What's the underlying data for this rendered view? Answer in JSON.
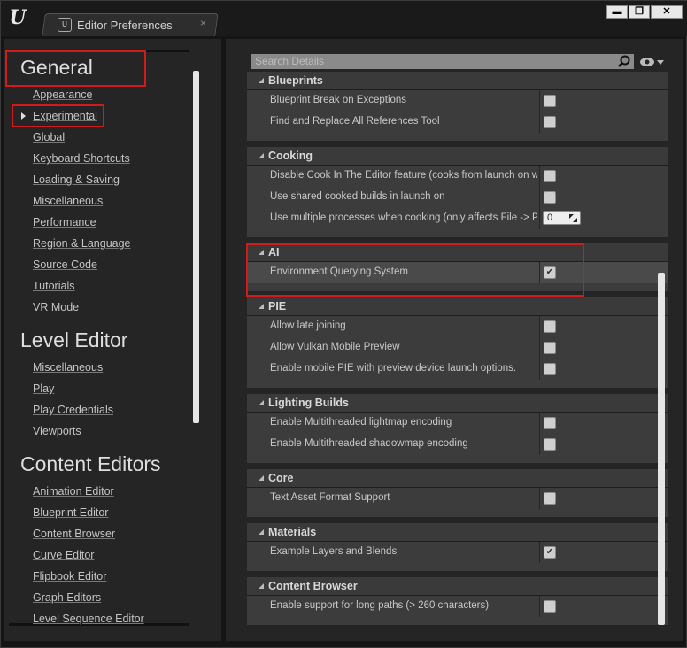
{
  "window": {
    "tab_title": "Editor Preferences",
    "tab_close_glyph": "×",
    "buttons": {
      "minimize": "▬",
      "maximize": "❐",
      "close": "✕"
    }
  },
  "sidebar": {
    "sections": [
      {
        "title": "General",
        "items": [
          "Appearance",
          "Experimental",
          "Global",
          "Keyboard Shortcuts",
          "Loading & Saving",
          "Miscellaneous",
          "Performance",
          "Region & Language",
          "Source Code",
          "Tutorials",
          "VR Mode"
        ]
      },
      {
        "title": "Level Editor",
        "items": [
          "Miscellaneous",
          "Play",
          "Play Credentials",
          "Viewports"
        ]
      },
      {
        "title": "Content Editors",
        "items": [
          "Animation Editor",
          "Blueprint Editor",
          "Content Browser",
          "Curve Editor",
          "Flipbook Editor",
          "Graph Editors",
          "Level Sequence Editor"
        ]
      }
    ],
    "selected": "Experimental"
  },
  "details": {
    "search_placeholder": "Search Details",
    "categories": [
      {
        "name": "Blueprints",
        "rows": [
          {
            "label": "Blueprint Break on Exceptions",
            "checked": false
          },
          {
            "label": "Find and Replace All References Tool",
            "checked": false
          }
        ]
      },
      {
        "name": "Cooking",
        "rows": [
          {
            "label": "Disable Cook In The Editor feature (cooks from launch on wil",
            "checked": false
          },
          {
            "label": "Use shared cooked builds in launch on",
            "checked": false
          },
          {
            "label": "Use multiple processes when cooking (only affects File -> Pa",
            "value": "0"
          }
        ]
      },
      {
        "name": "AI",
        "rows": [
          {
            "label": "Environment Querying System",
            "checked": true
          }
        ]
      },
      {
        "name": "PIE",
        "rows": [
          {
            "label": "Allow late joining",
            "checked": false
          },
          {
            "label": "Allow Vulkan Mobile Preview",
            "checked": false
          },
          {
            "label": "Enable mobile PIE with preview device launch options.",
            "checked": false
          }
        ]
      },
      {
        "name": "Lighting Builds",
        "rows": [
          {
            "label": "Enable Multithreaded lightmap encoding",
            "checked": false
          },
          {
            "label": "Enable Multithreaded shadowmap encoding",
            "checked": false
          }
        ]
      },
      {
        "name": "Core",
        "rows": [
          {
            "label": "Text Asset Format Support",
            "checked": false
          }
        ]
      },
      {
        "name": "Materials",
        "rows": [
          {
            "label": "Example Layers and Blends",
            "checked": true
          }
        ]
      },
      {
        "name": "Content Browser",
        "rows": [
          {
            "label": "Enable support for long paths (> 260 characters)",
            "checked": false
          }
        ]
      }
    ]
  },
  "checkmark_glyph": "✔",
  "colors": {
    "highlight_box": "#d11a1a",
    "panel": "#252525",
    "row_bg": "#3c3c3c"
  }
}
